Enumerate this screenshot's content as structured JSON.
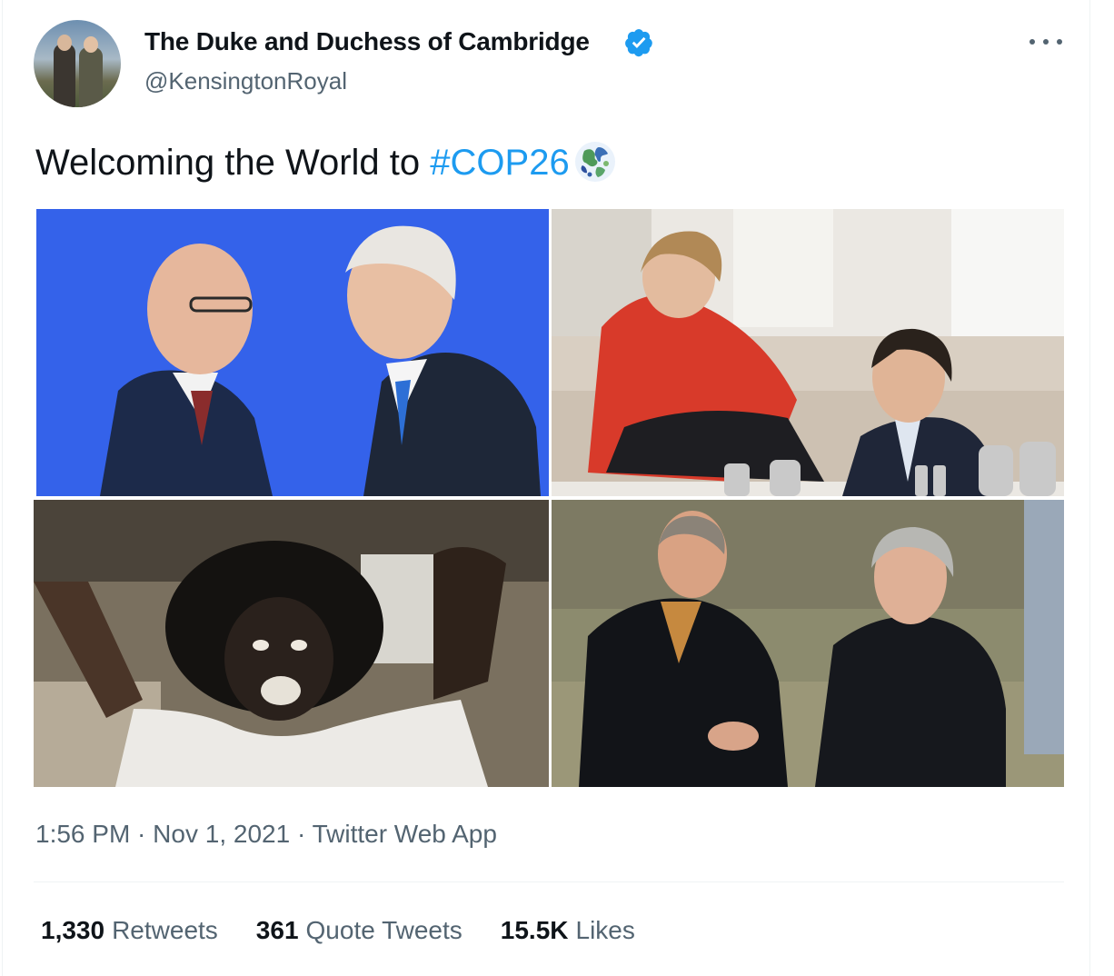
{
  "author": {
    "name": "The Duke and Duchess of Cambridge",
    "handle": "@KensingtonRoyal",
    "verified": true
  },
  "tweet": {
    "text": "Welcoming the World to ",
    "hashtag": "#COP26",
    "emoji": "earth-globe-icon"
  },
  "media": [
    {
      "tile": 1,
      "description_icon": "photo"
    },
    {
      "tile": 2,
      "description_icon": "photo"
    },
    {
      "tile": 3,
      "description_icon": "photo"
    },
    {
      "tile": 4,
      "description_icon": "photo"
    }
  ],
  "meta": {
    "time": "1:56 PM",
    "date": "Nov 1, 2021",
    "source": "Twitter Web App",
    "separator": " · "
  },
  "stats": {
    "retweets_count": "1,330",
    "retweets_label": "Retweets",
    "quotes_count": "361",
    "quotes_label": "Quote Tweets",
    "likes_count": "15.5K",
    "likes_label": "Likes"
  },
  "colors": {
    "link": "#1d9bf0",
    "secondary_text": "#536471",
    "primary_text": "#0f1419",
    "divider": "#eff3f4"
  }
}
